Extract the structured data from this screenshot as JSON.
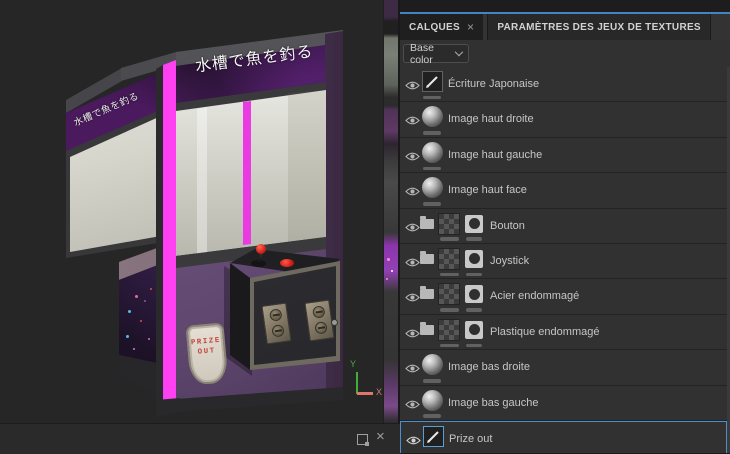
{
  "icons": {
    "close": "×"
  },
  "colors": {
    "accent_blue": "#4584c4",
    "selection_blue": "#4c8fd0",
    "neon_magenta": "#f03ce8",
    "panel_bg": "#313131",
    "viewport_bg": "#262626"
  },
  "panel": {
    "tabs": [
      {
        "label": "CALQUES",
        "active": true
      },
      {
        "label": "PARAMÈTRES DES JEUX DE TEXTURES",
        "active": false
      }
    ],
    "channel_selector": {
      "value": "Base color"
    },
    "layers": [
      {
        "label": "Écriture Japonaise",
        "type": "paint",
        "visible": true
      },
      {
        "label": "Image haut droite",
        "type": "fill",
        "visible": true
      },
      {
        "label": "Image haut gauche",
        "type": "fill",
        "visible": true
      },
      {
        "label": "Image haut face",
        "type": "fill",
        "visible": true
      },
      {
        "label": "Bouton",
        "type": "folder",
        "visible": true
      },
      {
        "label": "Joystick",
        "type": "folder",
        "visible": true
      },
      {
        "label": "Acier endommagé",
        "type": "folder",
        "visible": true
      },
      {
        "label": "Plastique endommagé",
        "type": "folder",
        "visible": true
      },
      {
        "label": "Image bas droite",
        "type": "fill",
        "visible": true
      },
      {
        "label": "Image bas gauche",
        "type": "fill",
        "visible": true
      },
      {
        "label": "Prize out",
        "type": "paint",
        "visible": true,
        "selected": true
      }
    ]
  },
  "viewport": {
    "machine": {
      "marquee_text": "水槽で魚を釣る",
      "side_text": "水槽で魚を釣る",
      "prize_sign_line1": "PRIZE",
      "prize_sign_line2": "OUT"
    },
    "axis": {
      "x_label": "X",
      "y_label": "Y"
    }
  }
}
